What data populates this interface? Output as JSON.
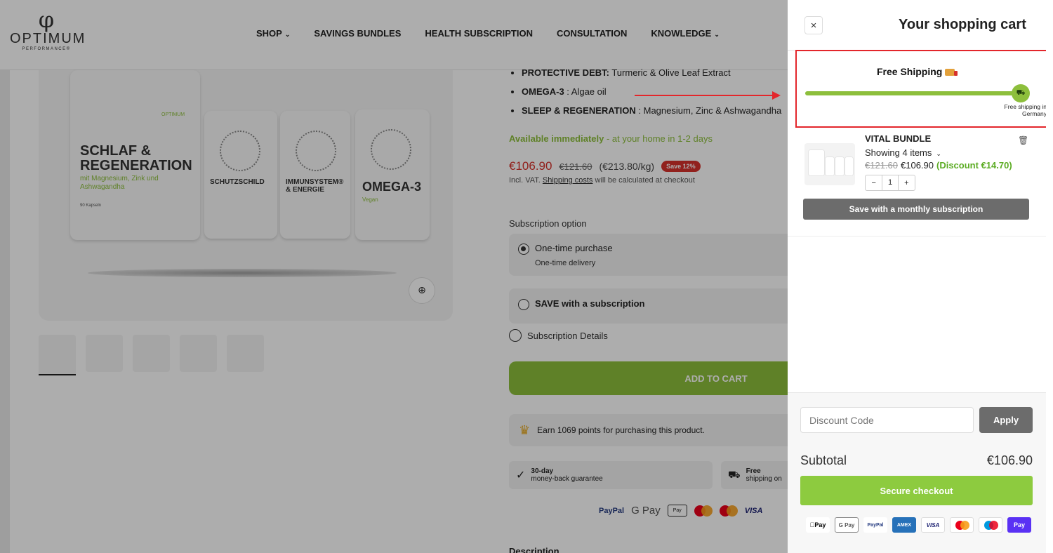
{
  "header": {
    "logo": {
      "brand": "OPTIMUM",
      "tagline": "PERFORMANCE®",
      "symbol": "φ"
    },
    "nav": [
      {
        "label": "SHOP",
        "has_dropdown": true
      },
      {
        "label": "SAVINGS BUNDLES",
        "has_dropdown": false
      },
      {
        "label": "HEALTH SUBSCRIPTION",
        "has_dropdown": false
      },
      {
        "label": "CONSULTATION",
        "has_dropdown": false
      },
      {
        "label": "KNOWLEDGE",
        "has_dropdown": true
      }
    ]
  },
  "product": {
    "image": {
      "pouch_main_title": "SCHLAF & REGENERATION",
      "pouch_main_sub": "mit Magnesium, Zink und Ashwagandha",
      "pouch_main_caps": "90 Kapseln",
      "pouch_2_title": "SCHUTZSCHILD",
      "pouch_3_title": "IMMUNSYSTEM® & ENERGIE",
      "pouch_4_title": "OMEGA-3",
      "pouch_4_sub": "Vegan",
      "brand_mini": "OPTIMUM"
    },
    "bullets": [
      {
        "bold": "PROTECTIVE DEBT:",
        "text": " Turmeric & Olive Leaf Extract"
      },
      {
        "bold": "OMEGA-3",
        "text": " : Algae oil"
      },
      {
        "bold": "SLEEP & REGENERATION",
        "text": " : Magnesium, Zinc & Ashwagandha"
      }
    ],
    "availability_bold": "Available immediately",
    "availability_rest": " - at your home in 1-2 days",
    "price_now": "€106.90",
    "price_old": "€121.60",
    "price_per_kg": "(€213.80/kg)",
    "save_badge": "Save 12%",
    "vat_prefix": "Incl. VAT. ",
    "vat_link": "Shipping costs",
    "vat_suffix": " will be calculated at checkout",
    "subscription_label": "Subscription option",
    "option_one_time": "One-time purchase",
    "option_one_time_sub": "One-time delivery",
    "option_subscription": "SAVE with a subscription",
    "subscription_details": "Subscription Details",
    "add_to_cart": "ADD TO CART",
    "points_text": "Earn 1069 points for purchasing this product.",
    "feature_1_title": "30-day",
    "feature_1_text": "money-back guarantee",
    "feature_2_title": "Free",
    "feature_2_text": "shipping on",
    "payments": [
      "PayPal",
      "G Pay",
      "Pay",
      "VISA"
    ],
    "description_title": "Description"
  },
  "cart": {
    "title": "Your shopping cart",
    "close_label": "×",
    "shipping": {
      "title": "Free Shipping",
      "progress": 1.0,
      "note": "Free shipping in Germany"
    },
    "item": {
      "name": "VITAL BUNDLE",
      "showing": "Showing 4 items",
      "price_old": "€121.60",
      "price_now": "€106.90",
      "discount": "(Discount €14.70)",
      "quantity": "1",
      "minus": "−",
      "plus": "+"
    },
    "subscription_button": "Save with a monthly subscription",
    "discount_placeholder": "Discount Code",
    "apply_label": "Apply",
    "subtotal_label": "Subtotal",
    "subtotal_value": "€106.90",
    "checkout_label": "Secure checkout",
    "pay_methods": [
      "Pay",
      "G Pay",
      "PayPal",
      "AMEX",
      "VISA",
      "Mastercard",
      "Maestro",
      "Pay"
    ]
  },
  "colors": {
    "accent_green": "#8dbf3c",
    "price_red": "#d6312b",
    "annotation_red": "#e3262b",
    "button_grey": "#6c6c6c"
  }
}
